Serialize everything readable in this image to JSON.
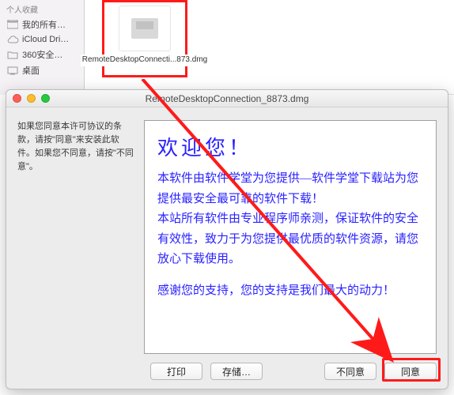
{
  "finder_sidebar": {
    "section": "个人收藏",
    "items": [
      {
        "label": "我的所有…"
      },
      {
        "label": "iCloud Dri…"
      },
      {
        "label": "360安全…"
      },
      {
        "label": "桌面"
      }
    ]
  },
  "file": {
    "name": "RemoteDesktopConnecti...873.dmg"
  },
  "window": {
    "title": "RemoteDesktopConnection_8873.dmg",
    "side_text": "如果您同意本许可协议的条款，请按\"同意\"来安装此软件。如果您不同意，请按\"不同意\"。",
    "welcome_heading": "欢迎您！",
    "welcome_body1": "本软件由软件学堂为您提供—软件学堂下载站为您提供最安全最可靠的软件下载！\n本站所有软件由专业程序师亲测，保证软件的安全有效性，致力于为您提供最优质的软件资源，请您放心下载使用。",
    "welcome_body2": "感谢您的支持，您的支持是我们最大的动力！",
    "buttons": {
      "print": "打印",
      "save": "存储…",
      "disagree": "不同意",
      "agree": "同意"
    }
  }
}
